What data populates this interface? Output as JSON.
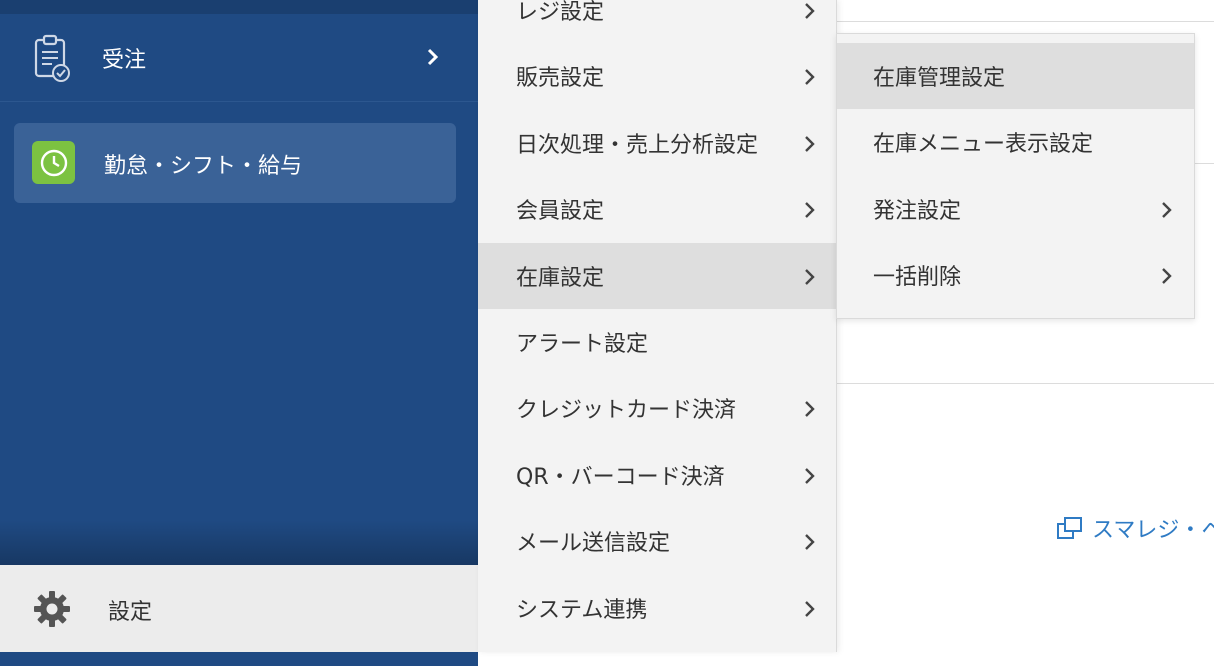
{
  "sidebar": {
    "order": {
      "label": "受注",
      "icon": "clipboard-check-icon"
    },
    "attendance": {
      "label": "勤怠・シフト・給与",
      "icon": "clock-icon",
      "icon_color": "#7cc241"
    },
    "settings": {
      "label": "設定",
      "icon": "gear-icon"
    }
  },
  "menu1": {
    "items": [
      {
        "label": "レジ設定",
        "has_submenu": true
      },
      {
        "label": "販売設定",
        "has_submenu": true
      },
      {
        "label": "日次処理・売上分析設定",
        "has_submenu": true
      },
      {
        "label": "会員設定",
        "has_submenu": true
      },
      {
        "label": "在庫設定",
        "has_submenu": true,
        "active": true
      },
      {
        "label": "アラート設定",
        "has_submenu": false
      },
      {
        "label": "クレジットカード決済",
        "has_submenu": true
      },
      {
        "label": "QR・バーコード決済",
        "has_submenu": true
      },
      {
        "label": "メール送信設定",
        "has_submenu": true
      },
      {
        "label": "システム連携",
        "has_submenu": true
      }
    ]
  },
  "menu2": {
    "items": [
      {
        "label": "在庫管理設定",
        "has_submenu": false,
        "active": true
      },
      {
        "label": "在庫メニュー表示設定",
        "has_submenu": false
      },
      {
        "label": "発注設定",
        "has_submenu": true
      },
      {
        "label": "一括削除",
        "has_submenu": true
      }
    ]
  },
  "background": {
    "link_label": "スマレジ・ヘ",
    "link_icon": "external-window-icon"
  },
  "colors": {
    "sidebar_bg": "#1f4a83",
    "sidebar_active_bg": "#3a6297",
    "menu_bg": "#f3f3f3",
    "menu_active_bg": "#dedede",
    "link_color": "#2f7bc4"
  }
}
